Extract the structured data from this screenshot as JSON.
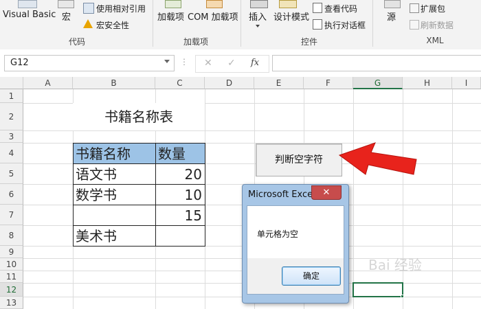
{
  "ribbon": {
    "visual_basic": "Visual Basic",
    "macro": "宏",
    "relative_ref": "使用相对引用",
    "macro_security": "宏安全性",
    "group_code": "代码",
    "addins": "加载项",
    "com_addins": "COM 加载项",
    "group_addins": "加载项",
    "insert": "插入",
    "design_mode": "设计模式",
    "view_code": "查看代码",
    "run_dialog": "执行对话框",
    "group_controls": "控件",
    "source": "源",
    "expansion_pack": "扩展包",
    "refresh_data": "刷新数据",
    "group_xml": "XML"
  },
  "formula_bar": {
    "name_box": "G12",
    "fx": "fx",
    "formula": ""
  },
  "sheet": {
    "columns": [
      "A",
      "B",
      "C",
      "D",
      "E",
      "F",
      "G",
      "H",
      "I"
    ],
    "rows": [
      "1",
      "2",
      "3",
      "4",
      "5",
      "6",
      "7",
      "8",
      "9",
      "10",
      "11",
      "12",
      "13"
    ],
    "title": "书籍名称表",
    "table_header": [
      "书籍名称",
      "数量"
    ],
    "table_rows": [
      [
        "语文书",
        "20"
      ],
      [
        "数学书",
        "10"
      ],
      [
        "",
        "15"
      ],
      [
        "美术书",
        ""
      ]
    ],
    "selected_cell": "G12"
  },
  "sheet_button": {
    "label": "判断空字符"
  },
  "dialog": {
    "title": "Microsoft Excel",
    "close": "✕",
    "message": "单元格为空",
    "ok": "确定"
  },
  "watermark": "Bai 经验",
  "colors": {
    "accent_green": "#217346",
    "header_fill": "#9dc3e6",
    "arrow_red": "#e8231c"
  }
}
